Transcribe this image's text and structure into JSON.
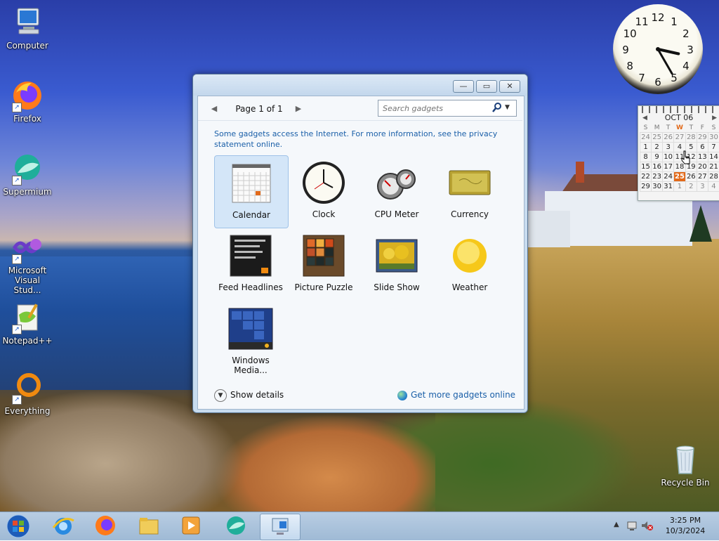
{
  "desktop": {
    "icons": [
      {
        "label": "Computer"
      },
      {
        "label": "Firefox"
      },
      {
        "label": "Supermium"
      },
      {
        "label": "Microsoft Visual Stud..."
      },
      {
        "label": "Notepad++"
      },
      {
        "label": "Everything"
      },
      {
        "label": "Recycle Bin"
      }
    ]
  },
  "clock_gadget": {
    "numbers": [
      "12",
      "1",
      "2",
      "3",
      "4",
      "5",
      "6",
      "7",
      "8",
      "9",
      "10",
      "11"
    ],
    "time": "3:25"
  },
  "calendar_gadget": {
    "month": "OCT 06",
    "weekdays": [
      "S",
      "M",
      "T",
      "W",
      "T",
      "F",
      "S"
    ],
    "weeks": [
      [
        "24",
        "25",
        "26",
        "27",
        "28",
        "29",
        "30"
      ],
      [
        "1",
        "2",
        "3",
        "4",
        "5",
        "6",
        "7"
      ],
      [
        "8",
        "9",
        "10",
        "11",
        "12",
        "13",
        "14"
      ],
      [
        "15",
        "16",
        "17",
        "18",
        "19",
        "20",
        "21"
      ],
      [
        "22",
        "23",
        "24",
        "25",
        "26",
        "27",
        "28"
      ],
      [
        "29",
        "30",
        "31",
        "1",
        "2",
        "3",
        "4"
      ]
    ],
    "today": "25"
  },
  "window": {
    "controls": {
      "minimize": "—",
      "restore": "▭",
      "close": "✕"
    },
    "pager": {
      "prev": "◀",
      "label": "Page 1 of 1",
      "next": "▶"
    },
    "search": {
      "placeholder": "Search gadgets",
      "icon": "search-icon",
      "dropdown": "▼"
    },
    "info_text": "Some gadgets access the Internet.  For more information, see the privacy statement online.",
    "gadgets": [
      {
        "label": "Calendar"
      },
      {
        "label": "Clock"
      },
      {
        "label": "CPU Meter"
      },
      {
        "label": "Currency"
      },
      {
        "label": "Feed Headlines"
      },
      {
        "label": "Picture Puzzle"
      },
      {
        "label": "Slide Show"
      },
      {
        "label": "Weather"
      },
      {
        "label": "Windows Media..."
      }
    ],
    "selected_gadget": "Calendar",
    "show_details": "Show details",
    "get_more": "Get more gadgets online"
  },
  "taskbar": {
    "tray": {
      "time": "3:25 PM",
      "date": "10/3/2024"
    }
  }
}
